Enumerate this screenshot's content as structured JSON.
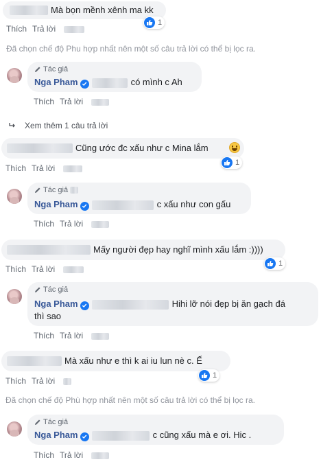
{
  "actions": {
    "like": "Thích",
    "reply": "Trả lời"
  },
  "author_badge": "Tác giả",
  "author_name": "Nga Pham",
  "notices": {
    "filter_1": "Đã chọn chế độ Phu hợp nhất nên một số câu trả lời có thể bị lọc ra.",
    "filter_2": "Đã chọn chế độ Phù hợp nhất nên một số câu trả lời có thể bị lọc ra."
  },
  "see_more": "Xem thêm 1 câu trả lời",
  "comments": [
    {
      "text": "Mà bọn mềnh xênh ma kk",
      "reactions": "1"
    },
    {
      "text": "có mình c Ah"
    },
    {
      "text": "Cũng ước đc xấu như c Mina lắm",
      "reactions": "1"
    },
    {
      "text": "c xấu như con gấu"
    },
    {
      "text": "Mấy người đẹp hay nghĩ mình xấu lắm :))))",
      "reactions": "1"
    },
    {
      "text_line1": "Hihi lỡ nói đẹp bị ăn gạch đá",
      "text_line2": "thì sao"
    },
    {
      "text": "Mà xấu như e thì k ai iu lun nè c. Ế",
      "reactions": "1"
    },
    {
      "text": "c cũng xấu mà e ơi. Hic ."
    }
  ],
  "colors": {
    "link": "#385898",
    "like_blue": "#1877f2",
    "bubble": "#f2f3f5",
    "meta": "#606770"
  }
}
